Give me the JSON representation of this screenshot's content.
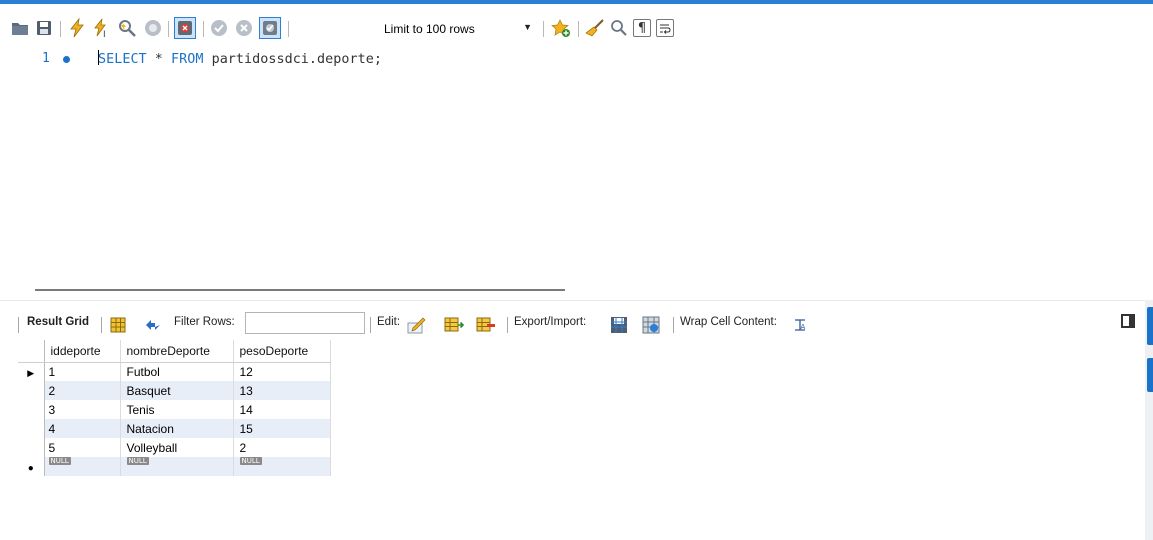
{
  "toolbar": {
    "limit_label": "Limit to 100 rows",
    "icons": [
      "open-folder-icon",
      "save-icon",
      "execute-lightning-icon",
      "execute-current-icon",
      "explain-icon",
      "stop-icon",
      "toggle-stop-on-error-icon",
      "commit-icon",
      "rollback-icon",
      "autocommit-icon",
      "add-snippet-star-icon",
      "beautify-broom-icon",
      "find-icon",
      "invisible-chars-icon",
      "word-wrap-icon"
    ]
  },
  "editor": {
    "line_number": "1",
    "code": {
      "kw_select": "SELECT",
      "star": " * ",
      "kw_from": "FROM",
      "target": " partidossdci.deporte;"
    }
  },
  "result_toolbar": {
    "result_grid": "Result Grid",
    "filter_rows": "Filter Rows:",
    "filter_value": "",
    "edit": "Edit:",
    "export_import": "Export/Import:",
    "wrap_cell": "Wrap Cell Content:"
  },
  "grid": {
    "columns": [
      "iddeporte",
      "nombreDeporte",
      "pesoDeporte"
    ],
    "rows": [
      [
        "1",
        "Futbol",
        "12"
      ],
      [
        "2",
        "Basquet",
        "13"
      ],
      [
        "3",
        "Tenis",
        "14"
      ],
      [
        "4",
        "Natacion",
        "15"
      ],
      [
        "5",
        "Volleyball",
        "2"
      ]
    ],
    "null_label": "NULL"
  },
  "colors": {
    "accent": "#1a73c8",
    "row_alt": "#e8eef8"
  }
}
